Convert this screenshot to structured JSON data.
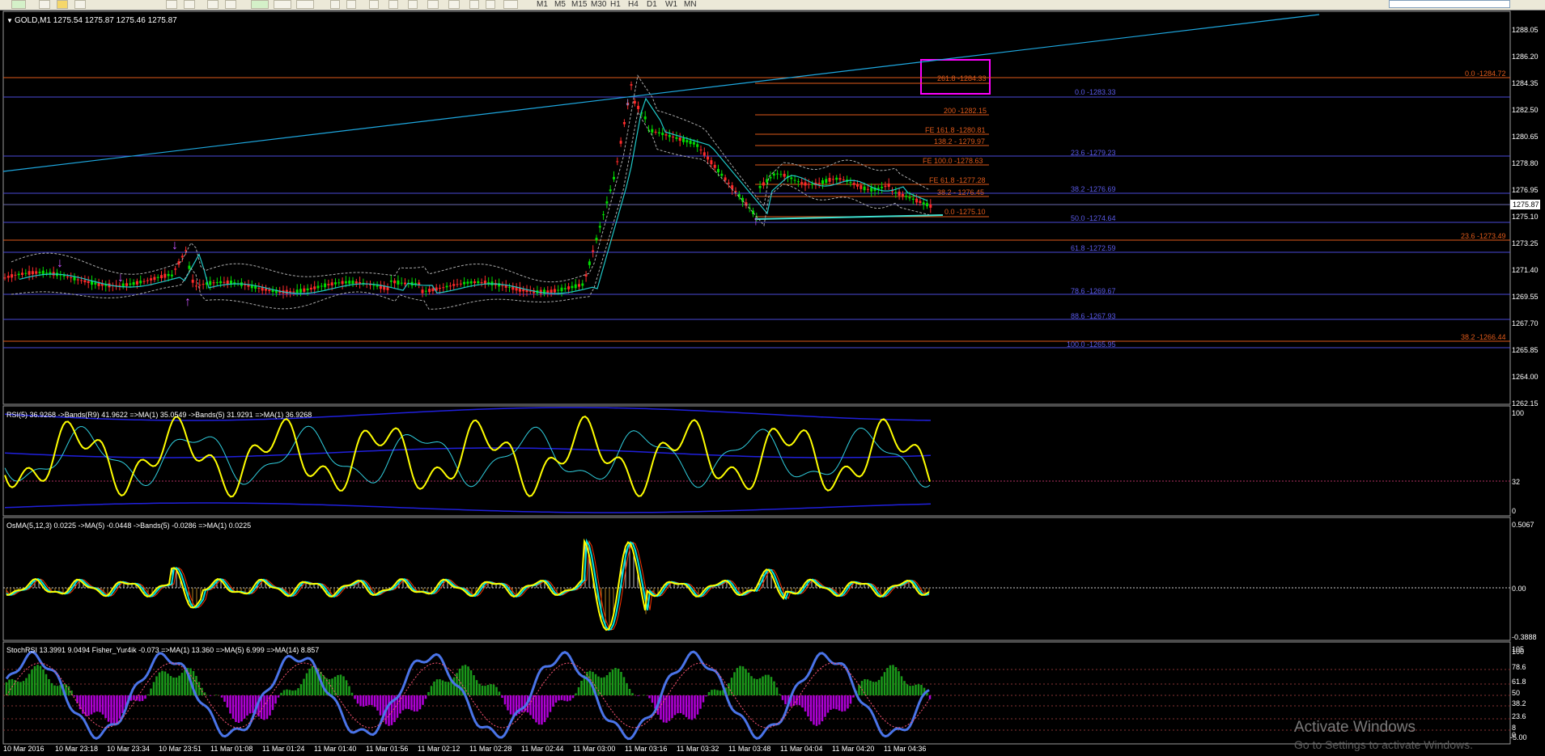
{
  "toolbar": {
    "timeframes": [
      "M1",
      "M5",
      "M15",
      "M30",
      "H1",
      "H4",
      "D1",
      "W1",
      "MN"
    ]
  },
  "main": {
    "title": "GOLD,M1  1275.54 1275.87 1275.46 1275.87",
    "price_ticks": [
      "1288.05",
      "1286.20",
      "1284.35",
      "1282.50",
      "1280.65",
      "1278.80",
      "1276.95",
      "1275.10",
      "1273.25",
      "1271.40",
      "1269.55",
      "1267.70",
      "1265.85",
      "1264.00",
      "1262.15"
    ],
    "current_price": "1275.87",
    "fib_blue": [
      "0.0 -1283.33",
      "23.6 -1279.23",
      "38.2 -1276.69",
      "50.0 -1274.64",
      "61.8 -1272.59",
      "78.6 -1269.67",
      "88.6 -1267.93",
      "100.0 -1265.95"
    ],
    "fib_orange_right": [
      "0.0 -1284.72",
      "23.6 -1273.49",
      "38.2 -1266.44"
    ],
    "fib_orange_mid": [
      "261.8 -1284.33",
      "200 -1282.15",
      "FE 161.8 -1280.81",
      "138.2 - 1279.97",
      "FE 100.0 -1278.63",
      "FE 61.8 -1277.28",
      "38.2 - 1276.45",
      "0.0 -1275.10"
    ]
  },
  "rsi": {
    "label": "RSI(5) 36.9268  ->Bands(R9) 41.9622  =>MA(1) 35.0549  ->Bands(5) 31.9291  =>MA(1) 36.9268",
    "ticks": [
      "100",
      "32",
      "0"
    ]
  },
  "osma": {
    "label": "OsMA(5,12,3) 0.0225  ->MA(5) -0.0448  ->Bands(5) -0.0286  =>MA(1) 0.0225",
    "ticks": [
      "0.5067",
      "0.00",
      "-0.3888"
    ]
  },
  "stoch": {
    "label": "StochRSI 13.3991 9.0494  Fisher_Yur4ik -0.073  =>MA(1) 13.360  =>MA(5) 6.999  =>MA(14) 8.857",
    "ticks": [
      "105",
      "100",
      "78.6",
      "61.8",
      "50",
      "38.2",
      "23.6",
      "8",
      "0",
      "-5.00"
    ]
  },
  "time_axis": [
    "10 Mar 2016",
    "10 Mar 23:18",
    "10 Mar 23:34",
    "10 Mar 23:51",
    "11 Mar 01:08",
    "11 Mar 01:24",
    "11 Mar 01:40",
    "11 Mar 01:56",
    "11 Mar 02:12",
    "11 Mar 02:28",
    "11 Mar 02:44",
    "11 Mar 03:00",
    "11 Mar 03:16",
    "11 Mar 03:32",
    "11 Mar 03:48",
    "11 Mar 04:04",
    "11 Mar 04:20",
    "11 Mar 04:36"
  ],
  "watermark": {
    "line1": "Activate Windows",
    "line2": "Go to Settings to activate Windows."
  },
  "colors": {
    "candle_up": "#00dd00",
    "candle_down": "#ff2a2a",
    "fib_blue": "#4a4ad8",
    "fib_orange": "#e05a1a",
    "trendline": "#1ea8e0",
    "highlight_box": "#ff00ff",
    "rsi_line": "#ffff00"
  }
}
